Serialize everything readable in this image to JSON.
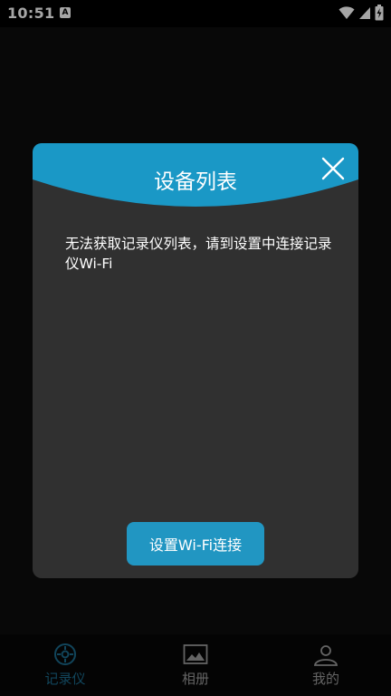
{
  "status_bar": {
    "time": "10:51",
    "notification_icon": "A"
  },
  "dialog": {
    "title": "设备列表",
    "message": "无法获取记录仪列表，请到设置中连接记录仪Wi-Fi",
    "primary_button": "设置Wi-Fi连接",
    "header_color": "#1a98c6",
    "body_color": "#303030"
  },
  "bottom_nav": {
    "items": [
      {
        "label": "记录仪",
        "icon": "recorder-icon",
        "active": true
      },
      {
        "label": "相册",
        "icon": "album-icon",
        "active": false
      },
      {
        "label": "我的",
        "icon": "profile-icon",
        "active": false
      }
    ],
    "accent_color": "#1b6a8c"
  }
}
